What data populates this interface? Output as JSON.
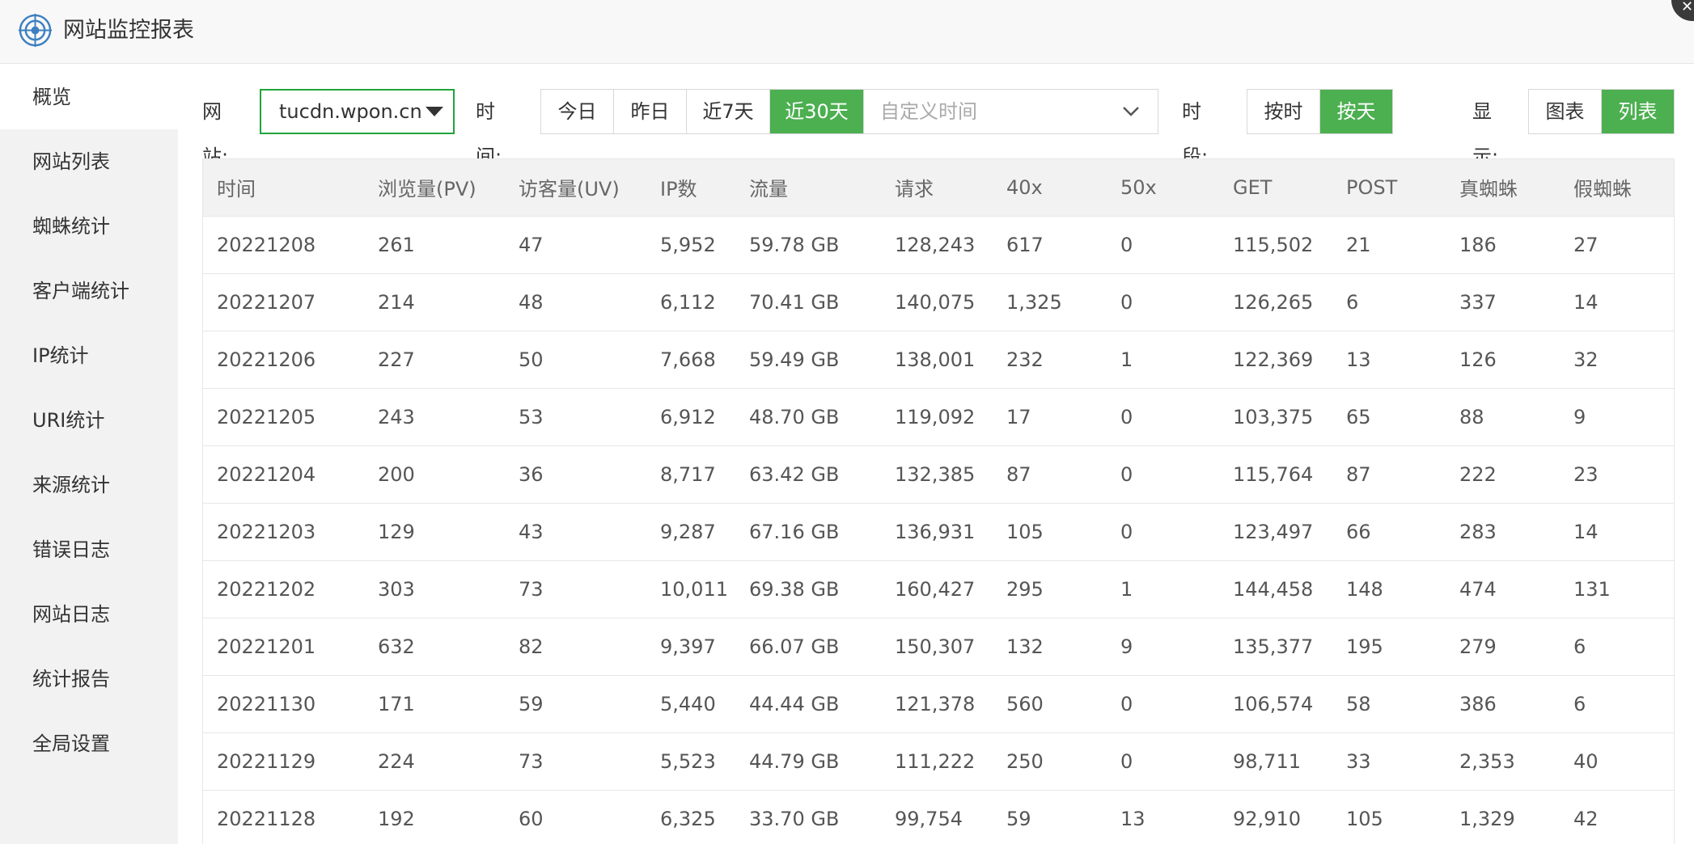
{
  "window": {
    "title": "网站监控报表",
    "logo_icon": "target-logo-icon",
    "close_glyph": "✕"
  },
  "sidebar": {
    "items": [
      {
        "label": "概览",
        "active": true
      },
      {
        "label": "网站列表"
      },
      {
        "label": "蜘蛛统计"
      },
      {
        "label": "客户端统计"
      },
      {
        "label": "IP统计"
      },
      {
        "label": "URI统计"
      },
      {
        "label": "来源统计"
      },
      {
        "label": "错误日志"
      },
      {
        "label": "网站日志"
      },
      {
        "label": "统计报告"
      },
      {
        "label": "全局设置"
      }
    ]
  },
  "toolbar": {
    "site_label": "网站:",
    "site_value": "tucdn.wpon.cn",
    "time_label": "时间:",
    "time_options": [
      "今日",
      "昨日",
      "近7天",
      "近30天"
    ],
    "time_active": "近30天",
    "custom_time_placeholder": "自定义时间",
    "period_label": "时段:",
    "period_options": [
      "按时",
      "按天"
    ],
    "period_active": "按天",
    "display_label": "显示:",
    "display_options": [
      "图表",
      "列表"
    ],
    "display_active": "列表"
  },
  "colors": {
    "accent": "#4caf50",
    "site_border": "#20a53a"
  },
  "table": {
    "columns": [
      "时间",
      "浏览量(PV)",
      "访客量(UV)",
      "IP数",
      "流量",
      "请求",
      "40x",
      "50x",
      "GET",
      "POST",
      "真蜘蛛",
      "假蜘蛛"
    ],
    "rows": [
      [
        "20221208",
        "261",
        "47",
        "5,952",
        "59.78 GB",
        "128,243",
        "617",
        "0",
        "115,502",
        "21",
        "186",
        "27"
      ],
      [
        "20221207",
        "214",
        "48",
        "6,112",
        "70.41 GB",
        "140,075",
        "1,325",
        "0",
        "126,265",
        "6",
        "337",
        "14"
      ],
      [
        "20221206",
        "227",
        "50",
        "7,668",
        "59.49 GB",
        "138,001",
        "232",
        "1",
        "122,369",
        "13",
        "126",
        "32"
      ],
      [
        "20221205",
        "243",
        "53",
        "6,912",
        "48.70 GB",
        "119,092",
        "17",
        "0",
        "103,375",
        "65",
        "88",
        "9"
      ],
      [
        "20221204",
        "200",
        "36",
        "8,717",
        "63.42 GB",
        "132,385",
        "87",
        "0",
        "115,764",
        "87",
        "222",
        "23"
      ],
      [
        "20221203",
        "129",
        "43",
        "9,287",
        "67.16 GB",
        "136,931",
        "105",
        "0",
        "123,497",
        "66",
        "283",
        "14"
      ],
      [
        "20221202",
        "303",
        "73",
        "10,011",
        "69.38 GB",
        "160,427",
        "295",
        "1",
        "144,458",
        "148",
        "474",
        "131"
      ],
      [
        "20221201",
        "632",
        "82",
        "9,397",
        "66.07 GB",
        "150,307",
        "132",
        "9",
        "135,377",
        "195",
        "279",
        "6"
      ],
      [
        "20221130",
        "171",
        "59",
        "5,440",
        "44.44 GB",
        "121,378",
        "560",
        "0",
        "106,574",
        "58",
        "386",
        "6"
      ],
      [
        "20221129",
        "224",
        "73",
        "5,523",
        "44.79 GB",
        "111,222",
        "250",
        "0",
        "98,711",
        "33",
        "2,353",
        "40"
      ],
      [
        "20221128",
        "192",
        "60",
        "6,325",
        "33.70 GB",
        "99,754",
        "59",
        "13",
        "92,910",
        "105",
        "1,329",
        "42"
      ]
    ]
  }
}
